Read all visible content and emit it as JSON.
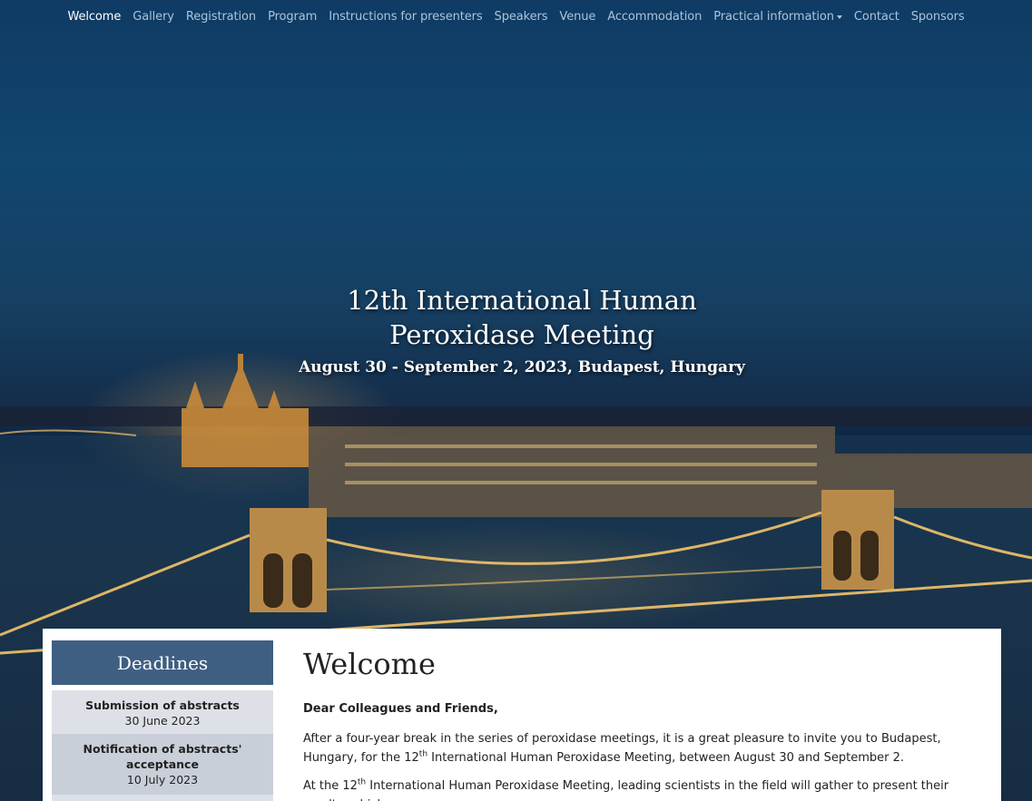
{
  "nav": {
    "items": [
      {
        "label": "Welcome",
        "active": true
      },
      {
        "label": "Gallery"
      },
      {
        "label": "Registration"
      },
      {
        "label": "Program"
      },
      {
        "label": "Instructions for presenters"
      },
      {
        "label": "Speakers"
      },
      {
        "label": "Venue"
      },
      {
        "label": "Accommodation"
      },
      {
        "label": "Practical information",
        "dropdown": true
      },
      {
        "label": "Contact"
      },
      {
        "label": "Sponsors"
      }
    ]
  },
  "hero": {
    "title": "12th International Human Peroxidase Meeting",
    "subtitle": "August 30 - September 2, 2023, Budapest, Hungary"
  },
  "sidebar": {
    "heading": "Deadlines",
    "deadlines": [
      {
        "title": "Submission of abstracts",
        "date": "30 June 2023"
      },
      {
        "title": "Notification of abstracts' acceptance",
        "date": "10 July 2023"
      }
    ]
  },
  "main": {
    "heading": "Welcome",
    "greeting": "Dear Colleagues and Friends,",
    "p1_a": "After a four-year break in the series of peroxidase meetings, it is a great pleasure to invite you to Budapest, Hungary, for the 12",
    "p1_sup": "th",
    "p1_b": " International Human Peroxidase Meeting, between August 30 and September 2.",
    "p2_a": "At the 12",
    "p2_sup": "th",
    "p2_b": " International Human Peroxidase Meeting, leading scientists in the field will gather to present their results, which"
  },
  "colors": {
    "nav_active": "#ffffff",
    "nav_text": "#aac4dc",
    "sidebar_header": "#3f5f82"
  }
}
